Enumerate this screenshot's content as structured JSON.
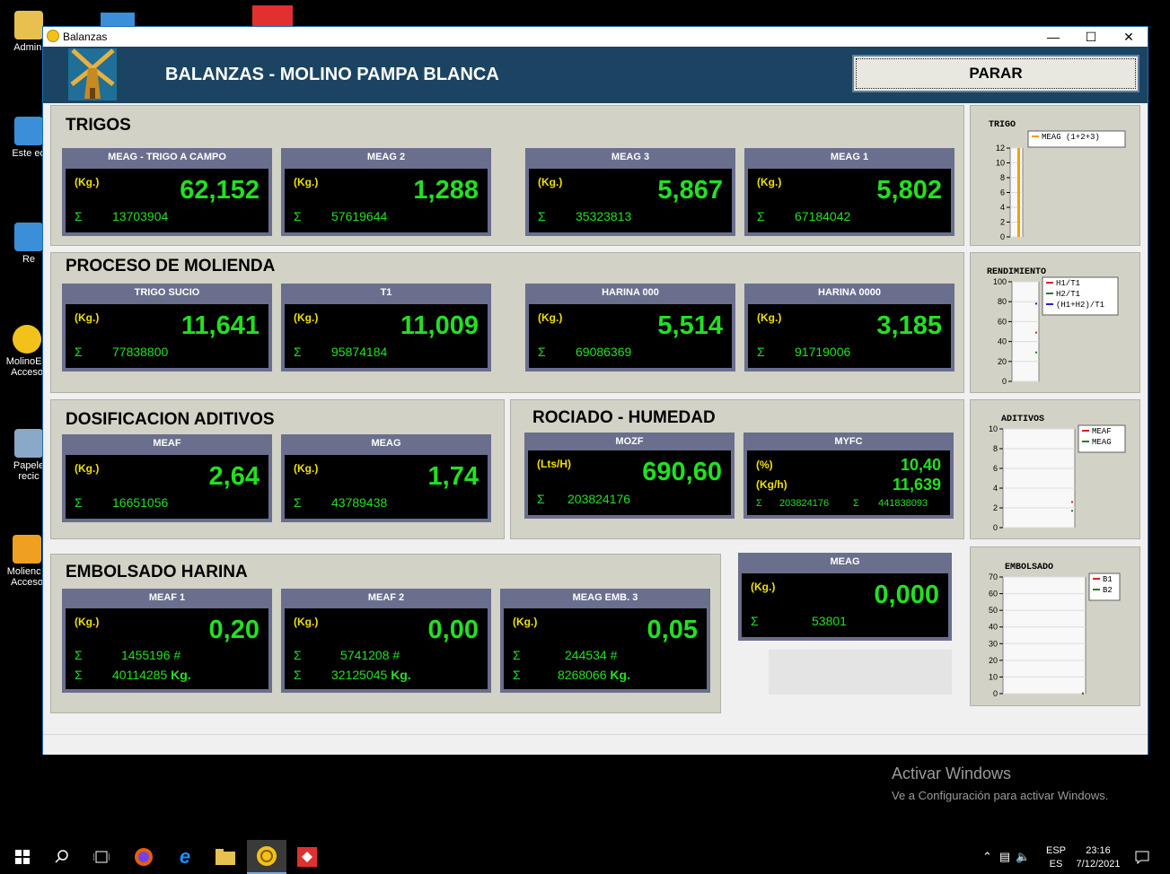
{
  "desktop": {
    "icons": [
      {
        "label": "Admini"
      },
      {
        "label": "Este eq"
      },
      {
        "label": "Re"
      },
      {
        "label": "MolinoE - Acceso"
      },
      {
        "label": "Papele recic"
      },
      {
        "label": "Molienc - Acceso"
      }
    ],
    "activation": {
      "title": "Activar Windows",
      "subtitle": "Ve a Configuración para activar Windows."
    }
  },
  "taskbar": {
    "lang_top": "ESP",
    "lang_bottom": "ES",
    "time": "23:16",
    "date": "7/12/2021"
  },
  "window": {
    "title": "Balanzas",
    "header_title": "BALANZAS - MOLINO PAMPA BLANCA",
    "stop_button": "PARAR"
  },
  "sections": {
    "trigos": {
      "title": "TRIGOS",
      "cards": [
        {
          "name": "MEAG - TRIGO A CAMPO",
          "unit": "(Kg.)",
          "value": "62,152",
          "sigma": "Σ",
          "total": "13703904"
        },
        {
          "name": "MEAG 2",
          "unit": "(Kg.)",
          "value": "1,288",
          "sigma": "Σ",
          "total": "57619644"
        },
        {
          "name": "MEAG 3",
          "unit": "(Kg.)",
          "value": "5,867",
          "sigma": "Σ",
          "total": "35323813"
        },
        {
          "name": "MEAG 1",
          "unit": "(Kg.)",
          "value": "5,802",
          "sigma": "Σ",
          "total": "67184042"
        }
      ]
    },
    "molienda": {
      "title": "PROCESO DE MOLIENDA",
      "cards": [
        {
          "name": "TRIGO SUCIO",
          "unit": "(Kg.)",
          "value": "11,641",
          "sigma": "Σ",
          "total": "77838800"
        },
        {
          "name": "T1",
          "unit": "(Kg.)",
          "value": "11,009",
          "sigma": "Σ",
          "total": "95874184"
        },
        {
          "name": "HARINA 000",
          "unit": "(Kg.)",
          "value": "5,514",
          "sigma": "Σ",
          "total": "69086369"
        },
        {
          "name": "HARINA 0000",
          "unit": "(Kg.)",
          "value": "3,185",
          "sigma": "Σ",
          "total": "91719006"
        }
      ]
    },
    "aditivos": {
      "title": "DOSIFICACION ADITIVOS",
      "cards": [
        {
          "name": "MEAF",
          "unit": "(Kg.)",
          "value": "2,64",
          "sigma": "Σ",
          "total": "16651056"
        },
        {
          "name": "MEAG",
          "unit": "(Kg.)",
          "value": "1,74",
          "sigma": "Σ",
          "total": "43789438"
        }
      ]
    },
    "rociado": {
      "title": "ROCIADO - HUMEDAD",
      "mozf": {
        "name": "MOZF",
        "unit": "(Lts/H)",
        "value": "690,60",
        "sigma": "Σ",
        "total": "203824176"
      },
      "myfc": {
        "name": "MYFC",
        "unit1": "(%)",
        "value1": "10,40",
        "unit2": "(Kg/h)",
        "value2": "11,639",
        "sigma": "Σ",
        "total1": "203824176",
        "total2": "441838093"
      }
    },
    "embolsado": {
      "title": "EMBOLSADO HARINA",
      "cards": [
        {
          "name": "MEAF 1",
          "unit": "(Kg.)",
          "value": "0,20",
          "sigma": "Σ",
          "count": "1455196",
          "count_suffix": "#",
          "total": "40114285",
          "total_suffix": "Kg."
        },
        {
          "name": "MEAF 2",
          "unit": "(Kg.)",
          "value": "0,00",
          "sigma": "Σ",
          "count": "5741208",
          "count_suffix": "#",
          "total": "32125045",
          "total_suffix": "Kg."
        },
        {
          "name": "MEAG EMB. 3",
          "unit": "(Kg.)",
          "value": "0,05",
          "sigma": "Σ",
          "count": "244534",
          "count_suffix": "#",
          "total": "8268066",
          "total_suffix": "Kg."
        }
      ]
    },
    "meag_standalone": {
      "name": "MEAG",
      "unit": "(Kg.)",
      "value": "0,000",
      "sigma": "Σ",
      "total": "53801"
    }
  },
  "chart_data": [
    {
      "type": "bar",
      "title": "TRIGO",
      "ylim": [
        0,
        12
      ],
      "yticks": [
        "0",
        "2",
        "4",
        "6",
        "8",
        "10",
        "12"
      ],
      "series": [
        {
          "name": "MEAG (1+2+3)",
          "values": [
            12
          ],
          "color": "#f0a000"
        }
      ],
      "legend": "right"
    },
    {
      "type": "line",
      "title": "RENDIMIENTO",
      "ylim": [
        0,
        100
      ],
      "yticks": [
        "0",
        "20",
        "40",
        "60",
        "80",
        "100"
      ],
      "series": [
        {
          "name": "H1/T1",
          "values": [
            49
          ],
          "color": "#e02020"
        },
        {
          "name": "H2/T1",
          "values": [
            29
          ],
          "color": "#208020"
        },
        {
          "name": "(H1+H2)/T1",
          "values": [
            78
          ],
          "color": "#2020d0"
        }
      ],
      "legend": "right"
    },
    {
      "type": "line",
      "title": "ADITIVOS",
      "ylim": [
        0,
        10
      ],
      "yticks": [
        "0",
        "2",
        "4",
        "6",
        "8",
        "10"
      ],
      "series": [
        {
          "name": "MEAF",
          "values": [
            2.6
          ],
          "color": "#e02020"
        },
        {
          "name": "MEAG",
          "values": [
            1.7
          ],
          "color": "#208020"
        }
      ],
      "legend": "right"
    },
    {
      "type": "line",
      "title": "EMBOLSADO",
      "ylim": [
        0,
        70
      ],
      "yticks": [
        "0",
        "10",
        "20",
        "30",
        "40",
        "50",
        "60",
        "70"
      ],
      "series": [
        {
          "name": "B1",
          "values": [
            0.2
          ],
          "color": "#e02020"
        },
        {
          "name": "B2",
          "values": [
            0.0
          ],
          "color": "#208020"
        }
      ],
      "legend": "right"
    }
  ]
}
